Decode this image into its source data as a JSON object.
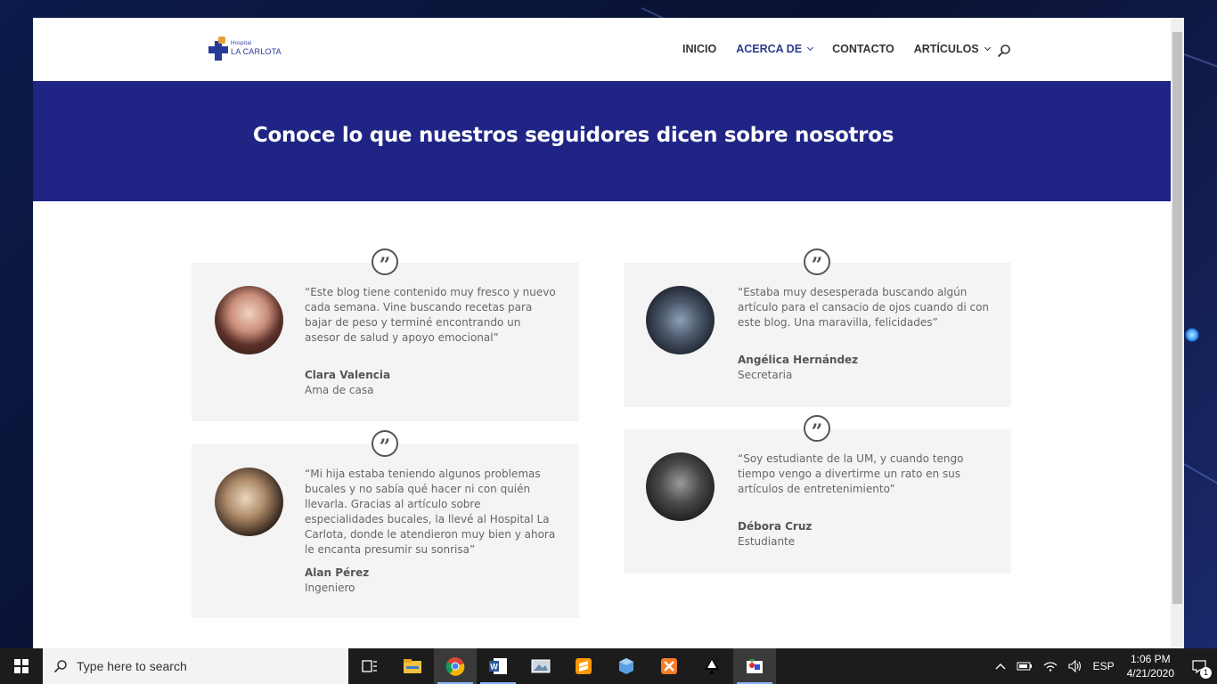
{
  "site": {
    "logo_small": "Hospital",
    "logo_name": "LA CARLOTA",
    "nav": [
      {
        "label": "INICIO"
      },
      {
        "label": "ACERCA DE"
      },
      {
        "label": "CONTACTO"
      },
      {
        "label": "ARTÍCULOS"
      }
    ],
    "hero_title": "Conoce lo que nuestros seguidores dicen sobre nosotros",
    "brand_color": "#1f2485",
    "quote_mark": "”"
  },
  "testimonials": [
    {
      "quote": "“Este blog tiene contenido muy fresco y nuevo cada semana. Vine buscando recetas para bajar de peso y terminé encontrando un asesor de salud y apoyo emocional”",
      "name": "Clara Valencia",
      "role": "Ama de casa"
    },
    {
      "quote": "“Estaba muy desesperada buscando algún artículo para el cansacio de ojos cuando di con este blog. Una maravilla, felicidades”",
      "name": "Angélica Hernández",
      "role": "Secretaria"
    },
    {
      "quote": "“Mi hija estaba teniendo algunos problemas bucales y no sabía qué hacer ni con quién llevarla. Gracias al artículo sobre especialidades bucales, la llevé al Hospital La Carlota, donde le atendieron muy bien y ahora le encanta presumir su sonrisa”",
      "name": "Alan Pérez",
      "role": "Ingeniero"
    },
    {
      "quote": "“Soy estudiante de la UM, y cuando tengo tiempo vengo a divertirme un rato en sus artículos de entretenimiento”",
      "name": "Débora Cruz",
      "role": "Estudiante"
    }
  ],
  "taskbar": {
    "search_placeholder": "Type here to search",
    "apps": [
      "task-view-icon",
      "file-explorer-icon",
      "chrome-icon",
      "word-icon",
      "photos-icon",
      "sublime-text-icon",
      "virtualbox-icon",
      "xampp-icon",
      "inkscape-icon",
      "paint-icon"
    ],
    "language": "ESP",
    "time": "1:06 PM",
    "date": "4/21/2020",
    "notification_count": "1"
  }
}
